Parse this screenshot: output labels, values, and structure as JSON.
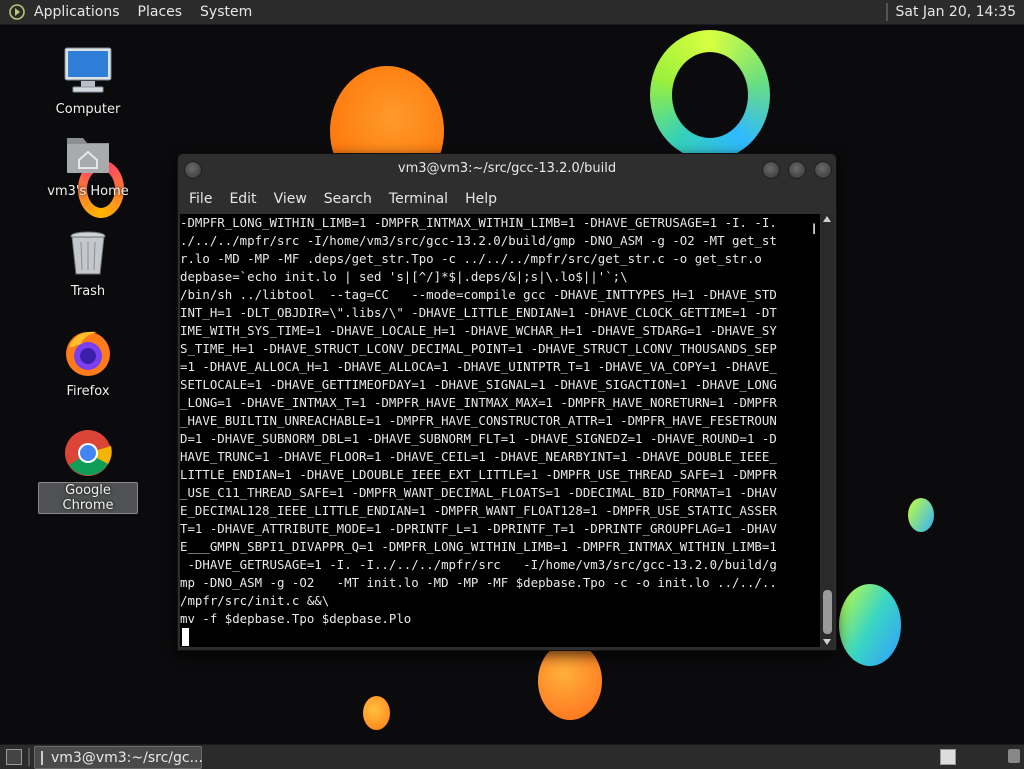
{
  "top_panel": {
    "menus": [
      "Applications",
      "Places",
      "System"
    ],
    "clock": "Sat Jan 20, 14:35"
  },
  "desktop_icons": [
    {
      "label": "Computer",
      "icon": "computer-icon"
    },
    {
      "label": "vm3's Home",
      "icon": "home-folder-icon"
    },
    {
      "label": "Trash",
      "icon": "trash-icon"
    },
    {
      "label": "Firefox",
      "icon": "firefox-icon"
    },
    {
      "label": "Google Chrome",
      "icon": "chrome-icon",
      "selected": true
    }
  ],
  "window": {
    "title": "vm3@vm3:~/src/gcc-13.2.0/build",
    "menu": [
      "File",
      "Edit",
      "View",
      "Search",
      "Terminal",
      "Help"
    ],
    "lines": [
      "-DMPFR_LONG_WITHIN_LIMB=1 -DMPFR_INTMAX_WITHIN_LIMB=1 -DHAVE_GETRUSAGE=1 -I. -I.",
      "./../../mpfr/src -I/home/vm3/src/gcc-13.2.0/build/gmp -DNO_ASM -g -O2 -MT get_st",
      "r.lo -MD -MP -MF .deps/get_str.Tpo -c ../../../mpfr/src/get_str.c -o get_str.o",
      "depbase=`echo init.lo | sed 's|[^/]*$|.deps/&|;s|\\.lo$||'`;\\",
      "/bin/sh ../libtool  --tag=CC   --mode=compile gcc -DHAVE_INTTYPES_H=1 -DHAVE_STD",
      "INT_H=1 -DLT_OBJDIR=\\\".libs/\\\" -DHAVE_LITTLE_ENDIAN=1 -DHAVE_CLOCK_GETTIME=1 -DT",
      "IME_WITH_SYS_TIME=1 -DHAVE_LOCALE_H=1 -DHAVE_WCHAR_H=1 -DHAVE_STDARG=1 -DHAVE_SY",
      "S_TIME_H=1 -DHAVE_STRUCT_LCONV_DECIMAL_POINT=1 -DHAVE_STRUCT_LCONV_THOUSANDS_SEP",
      "=1 -DHAVE_ALLOCA_H=1 -DHAVE_ALLOCA=1 -DHAVE_UINTPTR_T=1 -DHAVE_VA_COPY=1 -DHAVE_",
      "SETLOCALE=1 -DHAVE_GETTIMEOFDAY=1 -DHAVE_SIGNAL=1 -DHAVE_SIGACTION=1 -DHAVE_LONG",
      "_LONG=1 -DHAVE_INTMAX_T=1 -DMPFR_HAVE_INTMAX_MAX=1 -DMPFR_HAVE_NORETURN=1 -DMPFR",
      "_HAVE_BUILTIN_UNREACHABLE=1 -DMPFR_HAVE_CONSTRUCTOR_ATTR=1 -DMPFR_HAVE_FESETROUN",
      "D=1 -DHAVE_SUBNORM_DBL=1 -DHAVE_SUBNORM_FLT=1 -DHAVE_SIGNEDZ=1 -DHAVE_ROUND=1 -D",
      "HAVE_TRUNC=1 -DHAVE_FLOOR=1 -DHAVE_CEIL=1 -DHAVE_NEARBYINT=1 -DHAVE_DOUBLE_IEEE_",
      "LITTLE_ENDIAN=1 -DHAVE_LDOUBLE_IEEE_EXT_LITTLE=1 -DMPFR_USE_THREAD_SAFE=1 -DMPFR",
      "_USE_C11_THREAD_SAFE=1 -DMPFR_WANT_DECIMAL_FLOATS=1 -DDECIMAL_BID_FORMAT=1 -DHAV",
      "E_DECIMAL128_IEEE_LITTLE_ENDIAN=1 -DMPFR_WANT_FLOAT128=1 -DMPFR_USE_STATIC_ASSER",
      "T=1 -DHAVE_ATTRIBUTE_MODE=1 -DPRINTF_L=1 -DPRINTF_T=1 -DPRINTF_GROUPFLAG=1 -DHAV",
      "E___GMPN_SBPI1_DIVAPPR_Q=1 -DMPFR_LONG_WITHIN_LIMB=1 -DMPFR_INTMAX_WITHIN_LIMB=1",
      " -DHAVE_GETRUSAGE=1 -I. -I../../../mpfr/src   -I/home/vm3/src/gcc-13.2.0/build/g",
      "mp -DNO_ASM -g -O2   -MT init.lo -MD -MP -MF $depbase.Tpo -c -o init.lo ../../..",
      "/mpfr/src/init.c &&\\",
      "mv -f $depbase.Tpo $depbase.Plo"
    ]
  },
  "taskbar": {
    "task_label": "vm3@vm3:~/src/gc..."
  }
}
